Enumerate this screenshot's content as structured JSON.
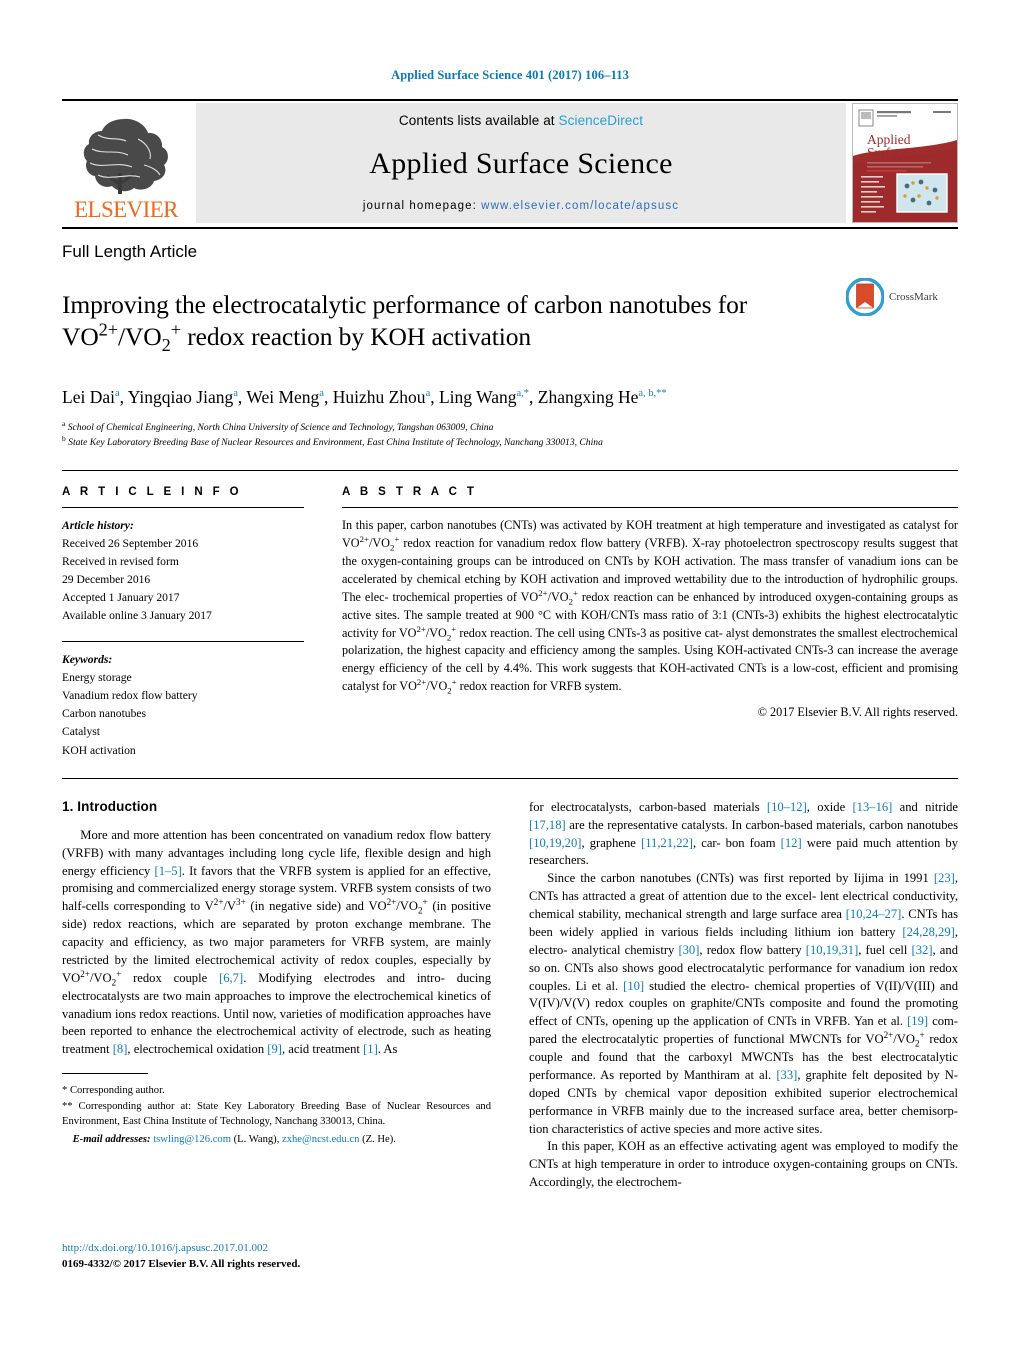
{
  "running_head": "Applied Surface Science 401 (2017) 106–113",
  "masthead": {
    "publisher_name": "ELSEVIER",
    "contents_prefix": "Contents lists available at ",
    "contents_link": "ScienceDirect",
    "journal_name": "Applied Surface Science",
    "homepage_prefix": "journal homepage: ",
    "homepage_url": "www.elsevier.com/locate/apsusc",
    "cover_title_line1": "Applied",
    "cover_title_line2": "Surface Science"
  },
  "article": {
    "type": "Full Length Article",
    "title_line1": "Improving the electrocatalytic performance of carbon nanotubes for",
    "title_line2_pre": "VO",
    "title_full": "Improving the electrocatalytic performance of carbon nanotubes for VO2+/VO2+ redox reaction by KOH activation",
    "title_line2_post": " redox reaction by KOH activation",
    "crossmark_label": "CrossMark",
    "authors_plain": "Lei Dai a, Yingqiao Jiang a, Wei Meng a, Huizhu Zhou a, Ling Wang a,*, Zhangxing He a,b,**",
    "affiliation_a": "School of Chemical Engineering, North China University of Science and Technology, Tangshan 063009, China",
    "affiliation_b": "State Key Laboratory Breeding Base of Nuclear Resources and Environment, East China Institute of Technology, Nanchang 330013, China"
  },
  "info": {
    "heading": "A R T I C L E   I N F O",
    "history_title": "Article history:",
    "history": [
      "Received 26 September 2016",
      "Received in revised form",
      "29 December 2016",
      "Accepted 1 January 2017",
      "Available online 3 January 2017"
    ],
    "keywords_title": "Keywords:",
    "keywords": [
      "Energy storage",
      "Vanadium redox flow battery",
      "Carbon nanotubes",
      "Catalyst",
      "KOH activation"
    ]
  },
  "abstract": {
    "heading": "A B S T R A C T",
    "copyright": "© 2017 Elsevier B.V. All rights reserved."
  },
  "intro": {
    "heading": "1.  Introduction"
  },
  "footnotes": {
    "star": "*  Corresponding author.",
    "doublestar": "**  Corresponding author at: State Key Laboratory Breeding Base of Nuclear Resources and Environment, East China Institute of Technology, Nanchang 330013, China.",
    "email_label": "E-mail addresses:",
    "email1": "tswling@126.com",
    "email1_owner": "(L. Wang),",
    "email2": "zxhe@ncst.edu.cn",
    "email2_owner": "(Z. He)."
  },
  "doi": {
    "url": "http://dx.doi.org/10.1016/j.apsusc.2017.01.002",
    "issn": "0169-4332/© 2017 Elsevier B.V. All rights reserved."
  },
  "colors": {
    "link_blue": "#0f7bb8",
    "header_blue": "#0b7ab5",
    "elsevier_orange": "#ea6a20",
    "masthead_grey": "#e9e9e9"
  }
}
